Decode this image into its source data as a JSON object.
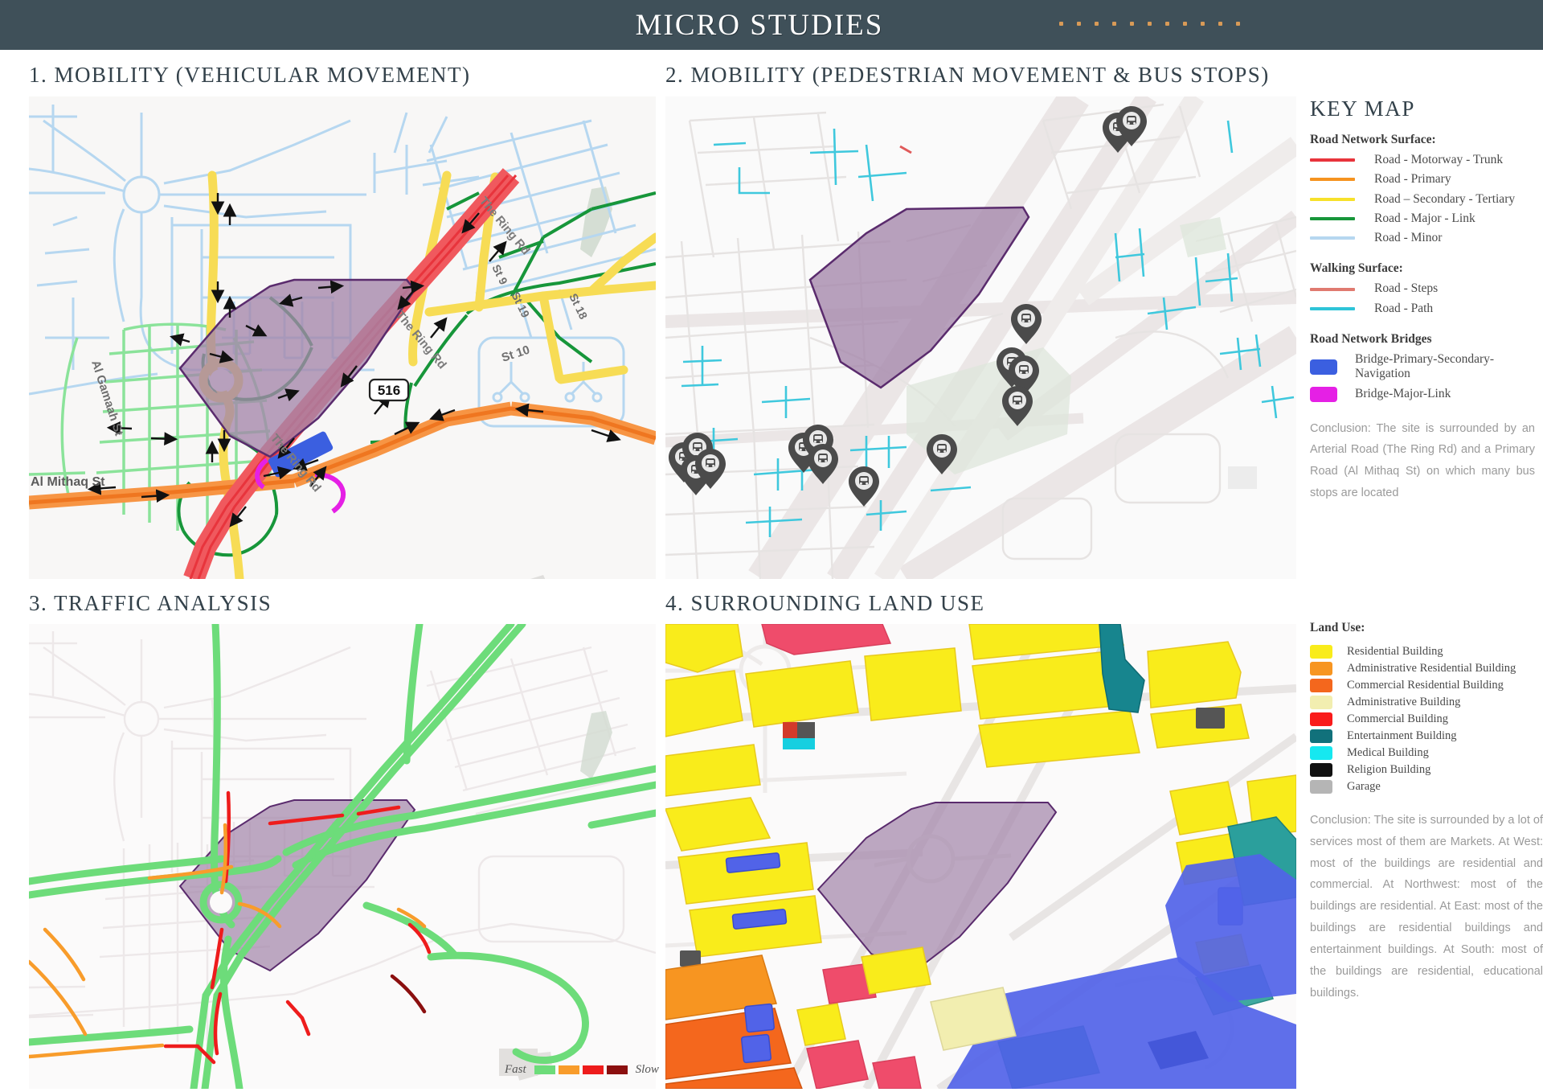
{
  "header": {
    "title": "MICRO STUDIES",
    "dots_count": 11,
    "bg_color": "#3f5059",
    "dot_color": "#d89a57"
  },
  "panels": [
    {
      "id": "panel-1",
      "title": "1. MOBILITY (VEHICULAR MOVEMENT)"
    },
    {
      "id": "panel-2",
      "title": "2. MOBILITY (PEDESTRIAN MOVEMENT & BUS STOPS)"
    },
    {
      "id": "panel-3",
      "title": "3. TRAFFIC ANALYSIS"
    },
    {
      "id": "panel-4",
      "title": "4. SURROUNDING LAND USE"
    }
  ],
  "map_labels": {
    "ring_road_1": "The Ring Rd",
    "ring_road_2": "The Ring Rd",
    "ring_road_3": "The Ring Rd",
    "highway_shield": "516",
    "al_gamaah": "Al Gamaah St",
    "al_mithaq": "Al Mithaq St",
    "st9": "St 9",
    "st19": "St 19",
    "st18": "St 18",
    "st10": "St 10"
  },
  "key_map": {
    "title": "KEY MAP",
    "sections": [
      {
        "heading": "Road Network Surface:",
        "items": [
          {
            "label": "Road - Motorway - Trunk",
            "color": "#e8343c",
            "swatch": "line"
          },
          {
            "label": "Road - Primary",
            "color": "#f5931f",
            "swatch": "line"
          },
          {
            "label": "Road – Secondary - Tertiary",
            "color": "#f7e12a",
            "swatch": "line"
          },
          {
            "label": "Road - Major - Link",
            "color": "#17963a",
            "swatch": "line"
          },
          {
            "label": "Road - Minor",
            "color": "#b6d7f0",
            "swatch": "line"
          }
        ]
      },
      {
        "heading": "Walking Surface:",
        "items": [
          {
            "label": "Road - Steps",
            "color": "#e07a70",
            "swatch": "line"
          },
          {
            "label": "Road - Path",
            "color": "#2ec4d8",
            "swatch": "line"
          }
        ]
      },
      {
        "heading": "Road Network Bridges",
        "items": [
          {
            "label": "Bridge-Primary-Secondary-Navigation",
            "color": "#3b5fe0",
            "swatch": "box"
          },
          {
            "label": "Bridge-Major-Link",
            "color": "#e520e5",
            "swatch": "box"
          }
        ]
      }
    ],
    "conclusion": "Conclusion:  The site is surrounded by an Arterial Road (The Ring Rd) and a Primary Road (Al Mithaq St) on which many bus stops are located"
  },
  "land_use": {
    "heading": "Land Use:",
    "items": [
      {
        "label": "Residential Building",
        "color": "#f9ec1b"
      },
      {
        "label": "Administrative Residential Building",
        "color": "#f79521"
      },
      {
        "label": "Commercial Residential Building",
        "color": "#f4671d"
      },
      {
        "label": "Administrative Building",
        "color": "#f2eeb0"
      },
      {
        "label": "Commercial Building",
        "color": "#f91b1b"
      },
      {
        "label": "Entertainment Building",
        "color": "#11717b"
      },
      {
        "label": "Medical Building",
        "color": "#16e8f0"
      },
      {
        "label": "Religion Building",
        "color": "#111111"
      },
      {
        "label": "Garage",
        "color": "#b5b5b5"
      }
    ],
    "conclusion": "Conclusion:  The site is surrounded by a lot of services most of them are Markets. At West: most of the buildings are residential and commercial. At Northwest: most of the buildings are residential. At East: most of the buildings are residential buildings and entertainment buildings. At South: most of the buildings are residential, educational buildings."
  },
  "traffic_legend": {
    "fast_label": "Fast",
    "slow_label": "Slow",
    "colors": [
      "#6ddc7a",
      "#f89c2b",
      "#ee1c1c",
      "#8b0f0f"
    ]
  }
}
